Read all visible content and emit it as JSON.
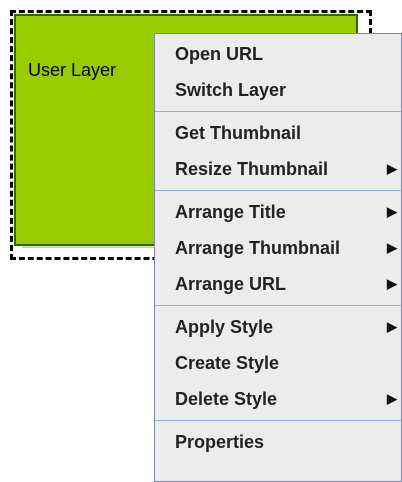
{
  "layer": {
    "label": "User Layer",
    "fill_color": "#99cc00"
  },
  "context_menu": {
    "groups": [
      [
        {
          "label": "Open URL",
          "submenu": false
        },
        {
          "label": "Switch Layer",
          "submenu": false
        }
      ],
      [
        {
          "label": "Get Thumbnail",
          "submenu": false
        },
        {
          "label": "Resize Thumbnail",
          "submenu": true
        }
      ],
      [
        {
          "label": "Arrange Title",
          "submenu": true
        },
        {
          "label": "Arrange Thumbnail",
          "submenu": true
        },
        {
          "label": "Arrange URL",
          "submenu": true
        }
      ],
      [
        {
          "label": "Apply Style",
          "submenu": true
        },
        {
          "label": "Create Style",
          "submenu": false
        },
        {
          "label": "Delete Style",
          "submenu": true
        }
      ],
      [
        {
          "label": "Properties",
          "submenu": false
        }
      ]
    ],
    "submenu_arrow": "▶"
  }
}
